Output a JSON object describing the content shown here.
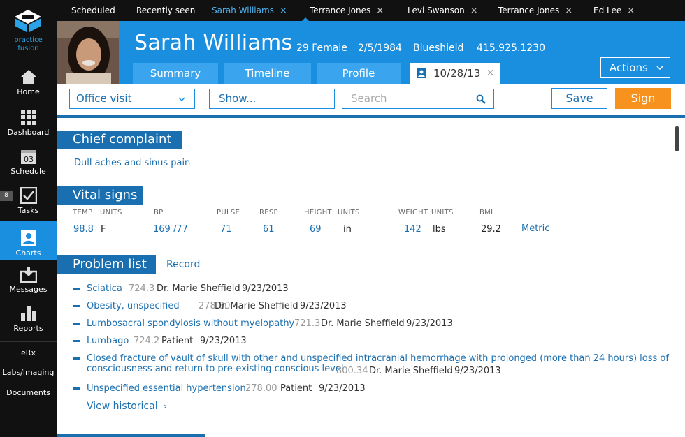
{
  "app": {
    "logo_line1": "practice",
    "logo_line2": "fusion"
  },
  "sidenav": {
    "items": [
      {
        "label": "Home"
      },
      {
        "label": "Dashboard"
      },
      {
        "label": "Schedule",
        "day": "03"
      },
      {
        "label": "Tasks",
        "badge": "8"
      },
      {
        "label": "Charts"
      },
      {
        "label": "Messages"
      },
      {
        "label": "Reports"
      }
    ],
    "text_links": [
      "eRx",
      "Labs/imaging",
      "Documents"
    ]
  },
  "top_tabs": [
    {
      "label": "Scheduled",
      "closable": false
    },
    {
      "label": "Recently seen",
      "closable": false
    },
    {
      "label": "Sarah Williams",
      "closable": true,
      "active": true
    },
    {
      "label": "Terrance Jones",
      "closable": true
    },
    {
      "label": "Levi Swanson",
      "closable": true
    },
    {
      "label": "Terrance Jones",
      "closable": true
    },
    {
      "label": "Ed Lee",
      "closable": true
    }
  ],
  "patient": {
    "name": "Sarah Williams",
    "age_sex": "29 Female",
    "dob": "2/5/1984",
    "insurance": "Blueshield",
    "phone": "415.925.1230"
  },
  "patient_tabs": [
    "Summary",
    "Timeline",
    "Profile"
  ],
  "encounter_tab": {
    "date": "10/28/13",
    "close": "×"
  },
  "actions_label": "Actions",
  "toolbar": {
    "visit_type": "Office visit",
    "show_label": "Show...",
    "search_placeholder": "Search",
    "save_label": "Save",
    "sign_label": "Sign"
  },
  "chief_complaint": {
    "heading": "Chief complaint",
    "text": "Dull aches and sinus pain"
  },
  "vitals": {
    "heading": "Vital signs",
    "labels": [
      "TEMP",
      "UNITS",
      "BP",
      "PULSE",
      "RESP",
      "HEIGHT",
      "UNITS",
      "WEIGHT",
      "UNITS",
      "BMI"
    ],
    "temp": "98.8",
    "temp_units": "F",
    "bp": "169 /77",
    "pulse": "71",
    "resp": "61",
    "height": "69",
    "height_units": "in",
    "weight": "142",
    "weight_units": "lbs",
    "bmi": "29.2",
    "metric_link": "Metric"
  },
  "problems": {
    "heading": "Problem list",
    "record_link": "Record",
    "items": [
      {
        "name": "Sciatica",
        "code": "724.3",
        "who": "Dr. Marie Sheffield",
        "date": "9/23/2013"
      },
      {
        "name": "Obesity, unspecified",
        "code": "278.00",
        "who": "Dr. Marie Sheffield",
        "date": "9/23/2013"
      },
      {
        "name": "Lumbosacral spondylosis without myelopathy",
        "code": "721.3",
        "who": "Dr. Marie Sheffield",
        "date": "9/23/2013"
      },
      {
        "name": "Lumbago",
        "code": "724.2",
        "who": "Patient",
        "date": "9/23/2013"
      },
      {
        "name_line1": "Closed fracture of vault of skull with other and unspecified intracranial hemorrhage with prolonged (more than 24 hours) loss of",
        "name_line2": "consciousness and return to pre-existing conscious level",
        "code": "800.34",
        "who": "Dr. Marie Sheffield",
        "date": "9/23/2013"
      },
      {
        "name": "Unspecified essential hypertension",
        "code": "278.00",
        "who": "Patient",
        "date": "9/23/2013"
      }
    ],
    "view_historical": "View historical"
  },
  "colors": {
    "brand_blue": "#1a8fe0",
    "dark_blue": "#1a6fb0",
    "sign_orange": "#f7921e",
    "nav_bg": "#111111"
  }
}
